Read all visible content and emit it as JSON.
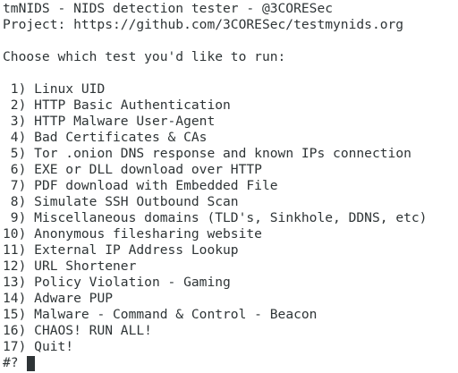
{
  "header": {
    "title": "tmNIDS - NIDS detection tester - @3CORESec",
    "project": "Project: https://github.com/3CORESec/testmynids.org"
  },
  "instruction": "Choose which test you'd like to run:",
  "menu": {
    "items": [
      {
        "num": " 1) ",
        "label": "Linux UID"
      },
      {
        "num": " 2) ",
        "label": "HTTP Basic Authentication"
      },
      {
        "num": " 3) ",
        "label": "HTTP Malware User-Agent"
      },
      {
        "num": " 4) ",
        "label": "Bad Certificates & CAs"
      },
      {
        "num": " 5) ",
        "label": "Tor .onion DNS response and known IPs connection"
      },
      {
        "num": " 6) ",
        "label": "EXE or DLL download over HTTP"
      },
      {
        "num": " 7) ",
        "label": "PDF download with Embedded File"
      },
      {
        "num": " 8) ",
        "label": "Simulate SSH Outbound Scan"
      },
      {
        "num": " 9) ",
        "label": "Miscellaneous domains (TLD's, Sinkhole, DDNS, etc)"
      },
      {
        "num": "10) ",
        "label": "Anonymous filesharing website"
      },
      {
        "num": "11) ",
        "label": "External IP Address Lookup"
      },
      {
        "num": "12) ",
        "label": "URL Shortener"
      },
      {
        "num": "13) ",
        "label": "Policy Violation - Gaming"
      },
      {
        "num": "14) ",
        "label": "Adware PUP"
      },
      {
        "num": "15) ",
        "label": "Malware - Command & Control - Beacon"
      },
      {
        "num": "16) ",
        "label": "CHAOS! RUN ALL!"
      },
      {
        "num": "17) ",
        "label": "Quit!"
      }
    ]
  },
  "prompt": {
    "symbol": "#?",
    "value": " "
  },
  "colors": {
    "background": "#ffffff",
    "foreground": "#2e3436",
    "cursor": "#2e3436"
  }
}
